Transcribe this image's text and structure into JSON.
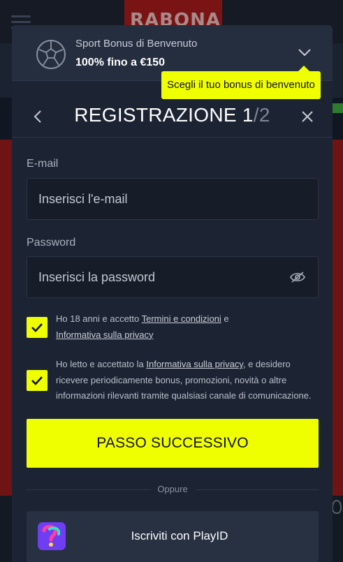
{
  "background": {
    "logo_text": "RABONA"
  },
  "bonus": {
    "title": "Sport Bonus di Benvenuto",
    "amount": "100% fino a €150",
    "tooltip": "Scegli il tuo bonus di benvenuto"
  },
  "registration": {
    "title_main": "REGISTRAZIONE 1",
    "title_sep_total": "/2"
  },
  "form": {
    "email_label": "E-mail",
    "email_placeholder": "Inserisci l'e-mail",
    "email_value": "",
    "password_label": "Password",
    "password_placeholder": "Inserisci la password",
    "password_value": ""
  },
  "consents": {
    "age": {
      "checked": true,
      "text_before": "Ho 18 anni e accetto ",
      "link1": "Termini e condizioni",
      "text_middle": " e ",
      "link2": "Informativa sulla privacy"
    },
    "marketing": {
      "checked": true,
      "text_before": "Ho letto e accettato la ",
      "link": "Informativa sulla privacy",
      "text_after": ", e desidero ricevere periodicamente bonus, promozioni, novità o altre informazioni rilevanti tramite qualsiasi canale di comunicazione."
    }
  },
  "actions": {
    "next_label": "PASSO SUCCESSIVO",
    "or_label": "Oppure",
    "playid_label": "Iscriviti con PlayID"
  },
  "colors": {
    "accent": "#f0ff00",
    "modal_bg": "#1c2433",
    "field_bg": "#161d29"
  }
}
